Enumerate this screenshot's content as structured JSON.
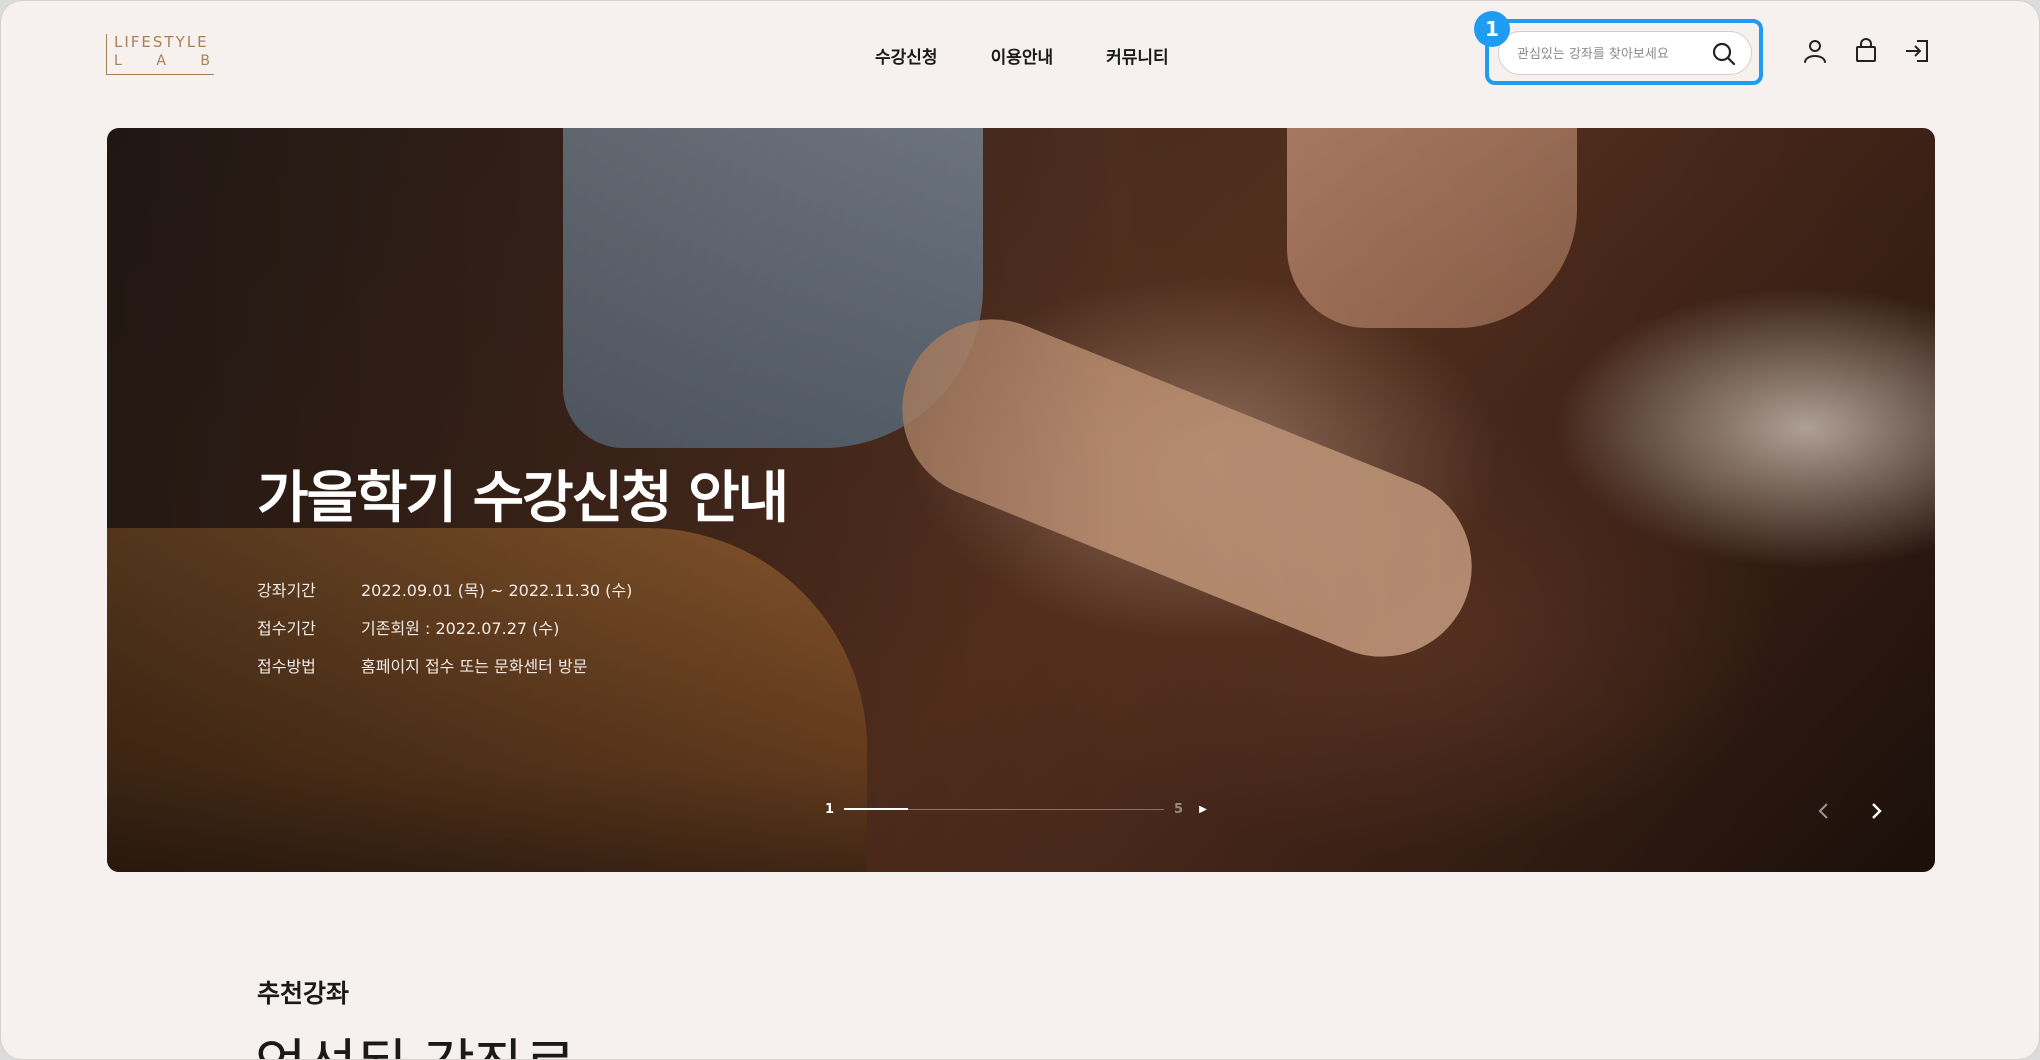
{
  "header": {
    "logo_top": "LIFESTYLE",
    "logo_bottom": [
      "L",
      "A",
      "B"
    ],
    "nav": [
      "수강신청",
      "이용안내",
      "커뮤니티"
    ],
    "search": {
      "placeholder": "관심있는 강좌를 찾아보세요",
      "value": "",
      "badge": "1"
    },
    "icons": [
      "user-icon",
      "bag-icon",
      "login-icon"
    ]
  },
  "hero": {
    "title": "가을학기 수강신청 안내",
    "info": [
      {
        "label": "강좌기간",
        "value": "2022.09.01 (목) ~ 2022.11.30 (수)"
      },
      {
        "label": "접수기간",
        "value": "기존회원 : 2022.07.27 (수)"
      },
      {
        "label": "접수방법",
        "value": "홈페이지 접수 또는 문화센터 방문"
      }
    ],
    "pager": {
      "current": "1",
      "total": "5",
      "progress": 0.2
    }
  },
  "section": {
    "label": "추천강좌",
    "heading": "엄선된 강좌로"
  },
  "colors": {
    "accent": "#1e9cf0",
    "brand": "#a8805a",
    "background": "#f6f1ee"
  }
}
